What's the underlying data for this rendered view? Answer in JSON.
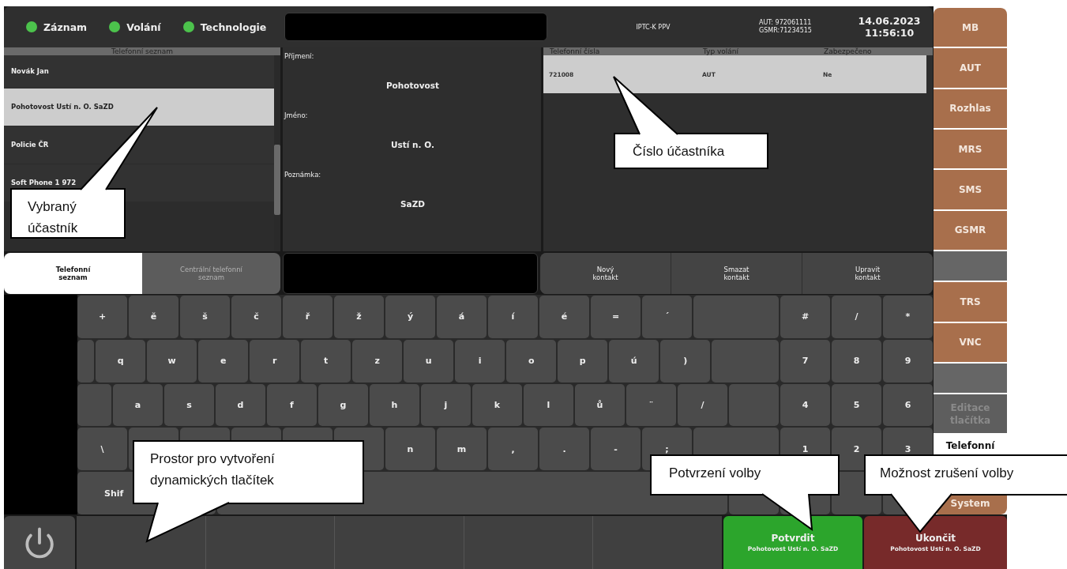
{
  "status_bar": {
    "indicators": [
      {
        "label": "Záznam",
        "on": true
      },
      {
        "label": "Volání",
        "on": true
      },
      {
        "label": "Technologie",
        "on": true
      }
    ],
    "station": "IPTC-K PPV",
    "numbers": [
      "AUT: 972061111",
      "GSMR:71234515"
    ],
    "date": "14.06.2023",
    "time": "11:56:10"
  },
  "contacts": {
    "title": "Telefonní seznam",
    "items": [
      {
        "name": "Novák Jan",
        "selected": false
      },
      {
        "name": "Pohotovost Ustí n. O. SaZD",
        "selected": true
      },
      {
        "name": "Policie ČR",
        "selected": false
      },
      {
        "name": "Soft Phone 1 972",
        "selected": false
      }
    ]
  },
  "details": {
    "fields": [
      {
        "label": "Příjmení:",
        "value": "Pohotovost"
      },
      {
        "label": "Jméno:",
        "value": "Ustí n. O."
      },
      {
        "label": "Poznámka:",
        "value": "SaZD"
      }
    ]
  },
  "numbers_table": {
    "columns": [
      "Telefonní čísla",
      "Typ volání",
      "Zabezpečeno"
    ],
    "rows": [
      {
        "cells": [
          "721008",
          "AUT",
          "Ne"
        ],
        "selected": true
      }
    ]
  },
  "tabs": [
    {
      "label": "Telefonní\nseznam",
      "selected": true
    },
    {
      "label": "Centrální telefonní\nseznam",
      "selected": false
    }
  ],
  "actions": [
    "Nový\nkontakt",
    "Smazat\nkontakt",
    "Upravit\nkontakt"
  ],
  "keyboard": {
    "rows": [
      [
        {
          "kind": "char",
          "label": "+"
        },
        {
          "kind": "char",
          "label": "ě"
        },
        {
          "kind": "char",
          "label": "š"
        },
        {
          "kind": "char",
          "label": "č"
        },
        {
          "kind": "char",
          "label": "ř"
        },
        {
          "kind": "char",
          "label": "ž"
        },
        {
          "kind": "char",
          "label": "ý"
        },
        {
          "kind": "char",
          "label": "á"
        },
        {
          "kind": "char",
          "label": "í"
        },
        {
          "kind": "char",
          "label": "é"
        },
        {
          "kind": "char",
          "label": "="
        },
        {
          "kind": "char",
          "label": "´"
        },
        {
          "kind": "wide"
        },
        {
          "kind": "char",
          "label": "#"
        },
        {
          "kind": "char",
          "label": "/"
        },
        {
          "kind": "char",
          "label": "*"
        }
      ],
      [
        {
          "kind": "stub"
        },
        {
          "kind": "char",
          "label": "q"
        },
        {
          "kind": "char",
          "label": "w"
        },
        {
          "kind": "char",
          "label": "e"
        },
        {
          "kind": "char",
          "label": "r"
        },
        {
          "kind": "char",
          "label": "t"
        },
        {
          "kind": "char",
          "label": "z"
        },
        {
          "kind": "char",
          "label": "u"
        },
        {
          "kind": "char",
          "label": "i"
        },
        {
          "kind": "char",
          "label": "o"
        },
        {
          "kind": "char",
          "label": "p"
        },
        {
          "kind": "char",
          "label": "ú"
        },
        {
          "kind": "char",
          "label": ")"
        },
        {
          "kind": "wide"
        },
        {
          "kind": "char",
          "label": "7"
        },
        {
          "kind": "char",
          "label": "8"
        },
        {
          "kind": "char",
          "label": "9"
        }
      ],
      [
        {
          "kind": "stub"
        },
        {
          "kind": "char",
          "label": "a"
        },
        {
          "kind": "char",
          "label": "s"
        },
        {
          "kind": "char",
          "label": "d"
        },
        {
          "kind": "char",
          "label": "f"
        },
        {
          "kind": "char",
          "label": "g"
        },
        {
          "kind": "char",
          "label": "h"
        },
        {
          "kind": "char",
          "label": "j"
        },
        {
          "kind": "char",
          "label": "k"
        },
        {
          "kind": "char",
          "label": "l"
        },
        {
          "kind": "char",
          "label": "ů"
        },
        {
          "kind": "char",
          "label": "¨"
        },
        {
          "kind": "char",
          "label": "/"
        },
        {
          "kind": "blank"
        },
        {
          "kind": "char",
          "label": "4"
        },
        {
          "kind": "char",
          "label": "5"
        },
        {
          "kind": "char",
          "label": "6"
        }
      ],
      [
        {
          "kind": "char",
          "label": "\\"
        },
        {
          "kind": "blank"
        },
        {
          "kind": "blank"
        },
        {
          "kind": "blank"
        },
        {
          "kind": "blank"
        },
        {
          "kind": "blank"
        },
        {
          "kind": "char",
          "label": "n"
        },
        {
          "kind": "char",
          "label": "m"
        },
        {
          "kind": "char",
          "label": ","
        },
        {
          "kind": "char",
          "label": "."
        },
        {
          "kind": "char",
          "label": "-"
        },
        {
          "kind": "char",
          "label": ";"
        },
        {
          "kind": "wide"
        },
        {
          "kind": "char",
          "label": "1"
        },
        {
          "kind": "char",
          "label": "2"
        },
        {
          "kind": "char",
          "label": "3"
        }
      ],
      [
        {
          "kind": "shift",
          "label": "Shif"
        },
        {
          "kind": "blank"
        },
        {
          "kind": "space"
        },
        {
          "kind": "blank"
        },
        {
          "kind": "blank"
        },
        {
          "kind": "blank"
        },
        {
          "kind": "blank"
        }
      ]
    ]
  },
  "sidebar": {
    "items": [
      {
        "kind": "app",
        "label": "MB",
        "selected": false,
        "disabled": false
      },
      {
        "kind": "app",
        "label": "AUT",
        "selected": false,
        "disabled": false
      },
      {
        "kind": "app",
        "label": "Rozhlas",
        "selected": false,
        "disabled": false
      },
      {
        "kind": "app",
        "label": "MRS",
        "selected": false,
        "disabled": false
      },
      {
        "kind": "app",
        "label": "SMS",
        "selected": false,
        "disabled": false
      },
      {
        "kind": "app",
        "label": "GSMR",
        "selected": false,
        "disabled": false
      },
      {
        "kind": "blank"
      },
      {
        "kind": "app",
        "label": "TRS",
        "selected": false,
        "disabled": false
      },
      {
        "kind": "app",
        "label": "VNC",
        "selected": false,
        "disabled": false
      },
      {
        "kind": "blank"
      },
      {
        "kind": "app",
        "label": "Editace\ntlačítka",
        "selected": false,
        "disabled": true
      },
      {
        "kind": "app",
        "label": "Telefonní",
        "selected": true,
        "disabled": false
      },
      {
        "kind": "app",
        "label": "System",
        "selected": false,
        "disabled": false
      }
    ]
  },
  "footer": {
    "confirm": {
      "label": "Potvrdit",
      "detail": "Pohotovost Ustí n. O. SaZD"
    },
    "cancel": {
      "label": "Ukončit",
      "detail": "Pohotovost Ustí n. O. SaZD"
    }
  },
  "callouts": [
    {
      "text": "Vybraný účastník"
    },
    {
      "text": "Číslo účastníka"
    },
    {
      "text": "Prostor pro vytvoření dynamických tlačítek"
    },
    {
      "text": "Potvrzení volby"
    },
    {
      "text": "Možnost zrušení volby"
    }
  ]
}
